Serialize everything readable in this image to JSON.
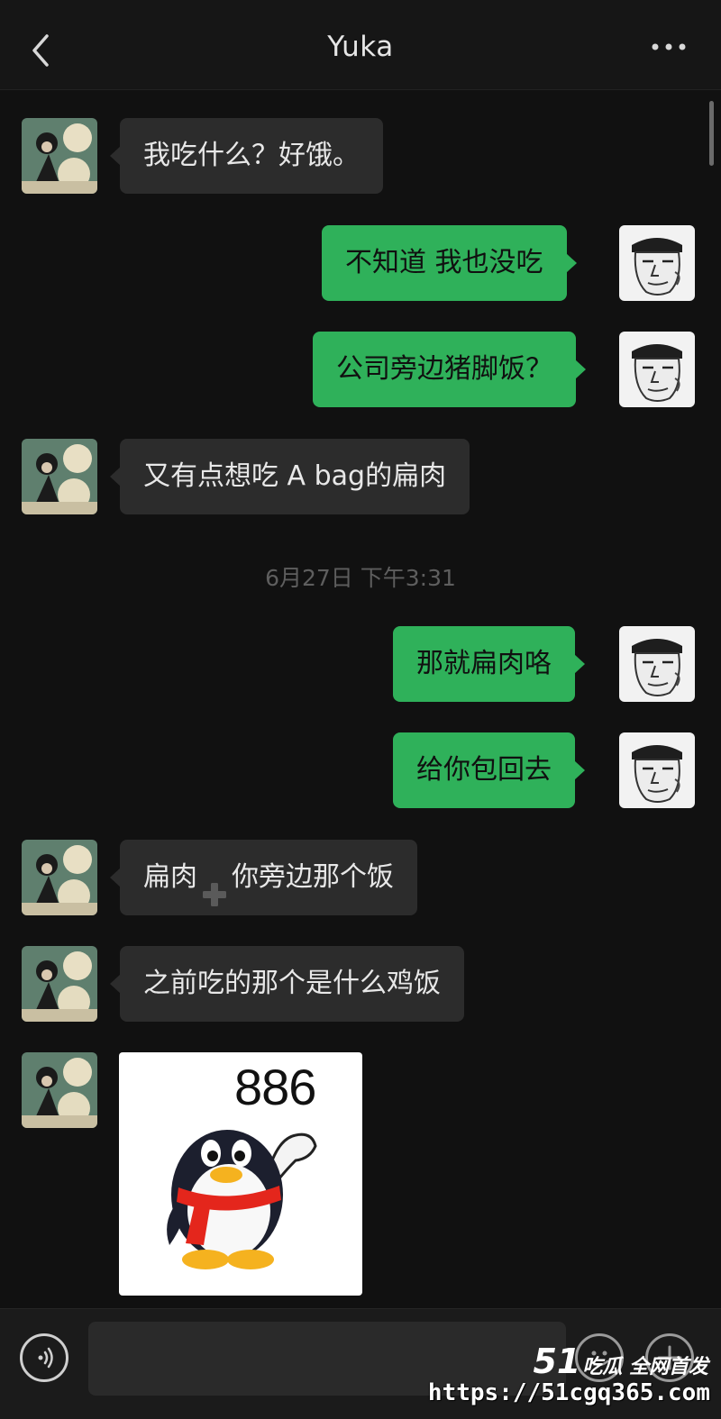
{
  "header": {
    "title": "Yuka"
  },
  "messages": [
    {
      "side": "left",
      "text": "我吃什么？好饿。"
    },
    {
      "side": "right",
      "text": "不知道 我也没吃"
    },
    {
      "side": "right",
      "text": "公司旁边猪脚饭？"
    },
    {
      "side": "left",
      "text": "又有点想吃 A bag的扁肉"
    },
    {
      "side": "right",
      "text": "那就扁肉咯"
    },
    {
      "side": "right",
      "text": "给你包回去"
    },
    {
      "side": "left",
      "text_before": "扁肉",
      "text_after": "你旁边那个饭"
    },
    {
      "side": "left",
      "text": "之前吃的那个是什么鸡饭"
    },
    {
      "side": "left",
      "sticker_text": "886"
    }
  ],
  "timestamp": "6月27日 下午3:31",
  "input": {
    "value": ""
  },
  "watermark": {
    "logo_number": "51",
    "logo_text": "吃瓜 全网首发",
    "url": "https://51cgq365.com"
  },
  "colors": {
    "background": "#111111",
    "bubble_left": "#2c2c2c",
    "bubble_right": "#2fb15a"
  }
}
